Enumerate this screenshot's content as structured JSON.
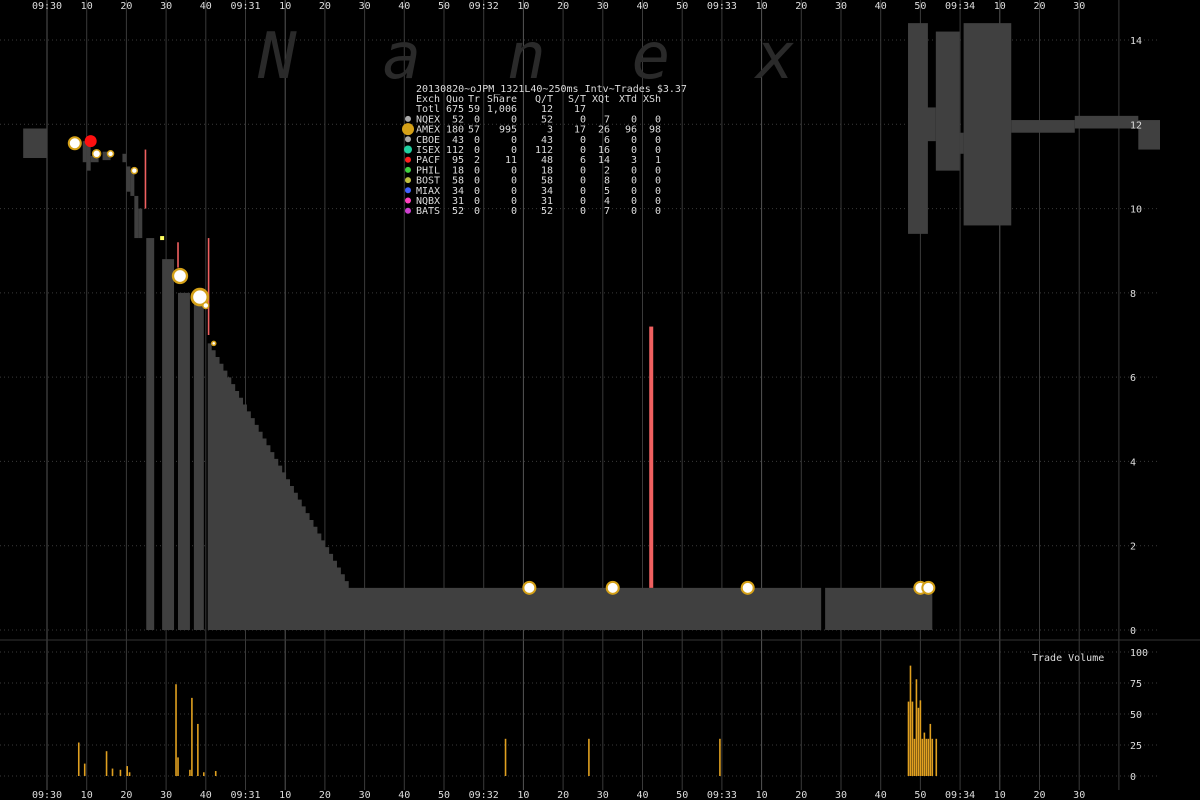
{
  "title": "20130820~oJPM_1321L40~250ms Intv~Trades $3.37",
  "watermark": "Nanex",
  "volume_label": "Trade Volume",
  "colors": {
    "background": "#000000",
    "grid": "#3a3a3a",
    "quote_band": "#404040",
    "text": "#dddddd",
    "pacf_spike": "#f06060",
    "volume_bar": "#e0a020",
    "amex_marker": "#d4a017"
  },
  "exchange_table": {
    "headers": [
      "Exch",
      "Quo",
      "Tr",
      "Share",
      "Q/T",
      "S/T",
      "XQt",
      "XTd",
      "XSh"
    ],
    "total": [
      "Totl",
      "675",
      "59",
      "1,006",
      "12",
      "17",
      "",
      "",
      ""
    ],
    "rows": [
      {
        "exch": "NQEX",
        "color": "#aaaaaa",
        "dot": 3,
        "cells": [
          "52",
          "0",
          "0",
          "52",
          "0",
          "7",
          "0",
          "0"
        ]
      },
      {
        "exch": "AMEX",
        "color": "#d4a017",
        "dot": 6,
        "cells": [
          "180",
          "57",
          "995",
          "3",
          "17",
          "26",
          "96",
          "98"
        ]
      },
      {
        "exch": "CBOE",
        "color": "#aaaaaa",
        "dot": 3,
        "cells": [
          "43",
          "0",
          "0",
          "43",
          "0",
          "6",
          "0",
          "0"
        ]
      },
      {
        "exch": "ISEX",
        "color": "#20d0a0",
        "dot": 4,
        "cells": [
          "112",
          "0",
          "0",
          "112",
          "0",
          "16",
          "0",
          "0"
        ]
      },
      {
        "exch": "PACF",
        "color": "#ff2020",
        "dot": 3,
        "cells": [
          "95",
          "2",
          "11",
          "48",
          "6",
          "14",
          "3",
          "1"
        ]
      },
      {
        "exch": "PHIL",
        "color": "#40d040",
        "dot": 3,
        "cells": [
          "18",
          "0",
          "0",
          "18",
          "0",
          "2",
          "0",
          "0"
        ]
      },
      {
        "exch": "BOST",
        "color": "#c0c040",
        "dot": 3,
        "cells": [
          "58",
          "0",
          "0",
          "58",
          "0",
          "8",
          "0",
          "0"
        ]
      },
      {
        "exch": "MIAX",
        "color": "#4060ff",
        "dot": 3,
        "cells": [
          "34",
          "0",
          "0",
          "34",
          "0",
          "5",
          "0",
          "0"
        ]
      },
      {
        "exch": "NQBX",
        "color": "#ff40c0",
        "dot": 3,
        "cells": [
          "31",
          "0",
          "0",
          "31",
          "0",
          "4",
          "0",
          "0"
        ]
      },
      {
        "exch": "BATS",
        "color": "#d040d0",
        "dot": 3,
        "cells": [
          "52",
          "0",
          "0",
          "52",
          "0",
          "7",
          "0",
          "0"
        ]
      }
    ]
  },
  "chart_data": [
    {
      "type": "area",
      "panel": "price",
      "x_unit": "seconds after 09:30:00",
      "xlim": [
        0,
        275
      ],
      "ylim": [
        0,
        14.6
      ],
      "y_ticks": [
        0,
        2,
        4,
        6,
        8,
        10,
        12,
        14
      ],
      "x_tick_labels": [
        "09:30",
        "10",
        "20",
        "30",
        "40",
        "09:31",
        "10",
        "20",
        "30",
        "40",
        "50",
        "09:32",
        "10",
        "20",
        "30",
        "40",
        "50",
        "09:33",
        "10",
        "20",
        "30",
        "40",
        "50",
        "09:34",
        "10",
        "20",
        "30"
      ],
      "x_major_ticks": [
        0,
        60,
        120,
        180,
        240
      ],
      "x_minor_step": 10,
      "grid": true,
      "quote_band": [
        {
          "x0": -6,
          "x1": 0,
          "lo": 11.2,
          "hi": 11.9
        },
        {
          "x0": 9,
          "x1": 10,
          "lo": 11.1,
          "hi": 11.6
        },
        {
          "x0": 10,
          "x1": 11,
          "lo": 10.9,
          "hi": 11.5
        },
        {
          "x0": 11,
          "x1": 13,
          "lo": 11.1,
          "hi": 11.25
        },
        {
          "x0": 14,
          "x1": 16,
          "lo": 11.15,
          "hi": 11.35
        },
        {
          "x0": 19,
          "x1": 20,
          "lo": 11.1,
          "hi": 11.3
        },
        {
          "x0": 20,
          "x1": 21,
          "lo": 10.4,
          "hi": 11.0
        },
        {
          "x0": 21,
          "x1": 22,
          "lo": 10.3,
          "hi": 10.9
        },
        {
          "x0": 22,
          "x1": 23,
          "lo": 9.3,
          "hi": 10.3
        },
        {
          "x0": 23,
          "x1": 24,
          "lo": 9.3,
          "hi": 10.0
        },
        {
          "x0": 25,
          "x1": 27,
          "lo": 0,
          "hi": 9.3
        },
        {
          "x0": 29,
          "x1": 32,
          "lo": 0,
          "hi": 8.8
        },
        {
          "x0": 33,
          "x1": 36,
          "lo": 0,
          "hi": 8.0
        },
        {
          "x0": 37,
          "x1": 39.5,
          "lo": 0,
          "hi": 7.8
        },
        {
          "x0": 40.5,
          "x1": 195,
          "lo": 0,
          "hi": 6.8,
          "descending_to": 1.0,
          "descend_end": 76
        },
        {
          "x0": 196,
          "x1": 223,
          "lo": 0,
          "hi": 1.0
        }
      ],
      "upper_band": [
        {
          "x0": 232,
          "x1": 237,
          "lo": 9.4,
          "hi": 14.4
        },
        {
          "x0": 232,
          "x1": 239,
          "lo": 11.6,
          "hi": 12.4
        },
        {
          "x0": 239,
          "x1": 245,
          "lo": 10.9,
          "hi": 14.2
        },
        {
          "x0": 245,
          "x1": 246,
          "lo": 11.3,
          "hi": 11.8
        },
        {
          "x0": 246,
          "x1": 258,
          "lo": 9.6,
          "hi": 14.4
        },
        {
          "x0": 258,
          "x1": 274,
          "lo": 11.8,
          "hi": 12.1
        },
        {
          "x0": 274,
          "x1": 290,
          "lo": 11.9,
          "hi": 12.2
        },
        {
          "x0": 290,
          "x1": 299,
          "lo": 11.4,
          "hi": 12.1
        }
      ],
      "pacf_spikes": [
        {
          "x": 24.8,
          "lo": 10.0,
          "hi": 11.4
        },
        {
          "x": 33.0,
          "lo": 8.6,
          "hi": 9.2
        },
        {
          "x": 40.7,
          "lo": 7.0,
          "hi": 9.3
        },
        {
          "x": 152.2,
          "lo": 1.0,
          "hi": 7.2
        }
      ],
      "series": [
        {
          "name": "AMEX",
          "marker": "white-ring",
          "points": [
            {
              "x": 7.0,
              "y": 11.55,
              "size": 6
            },
            {
              "x": 12.5,
              "y": 11.3,
              "size": 4
            },
            {
              "x": 16.0,
              "y": 11.3,
              "size": 3
            },
            {
              "x": 22.0,
              "y": 10.9,
              "size": 3
            },
            {
              "x": 33.5,
              "y": 8.4,
              "size": 7
            },
            {
              "x": 38.5,
              "y": 7.9,
              "size": 8
            },
            {
              "x": 40.0,
              "y": 7.7,
              "size": 3
            },
            {
              "x": 42.0,
              "y": 6.8,
              "size": 2
            },
            {
              "x": 121.5,
              "y": 1.0,
              "size": 6
            },
            {
              "x": 142.5,
              "y": 1.0,
              "size": 6
            },
            {
              "x": 176.5,
              "y": 1.0,
              "size": 6
            },
            {
              "x": 220.0,
              "y": 1.0,
              "size": 6
            },
            {
              "x": 222.0,
              "y": 1.0,
              "size": 6
            }
          ]
        },
        {
          "name": "PACF",
          "marker": "red-dot",
          "points": [
            {
              "x": 11.0,
              "y": 11.6,
              "size": 6
            }
          ]
        },
        {
          "name": "BOST",
          "marker": "yellow-square",
          "points": [
            {
              "x": 29.0,
              "y": 9.3,
              "size": 2
            }
          ]
        }
      ]
    },
    {
      "type": "bar",
      "panel": "volume",
      "title": "Trade Volume",
      "ylim": [
        0,
        100
      ],
      "y_ticks": [
        0,
        25,
        50,
        75,
        100
      ],
      "x": [
        8,
        9.5,
        15,
        16.5,
        18.5,
        20.2,
        20.8,
        32.5,
        33,
        36,
        36.5,
        38,
        39.5,
        42.5,
        115.5,
        136.5,
        169.5,
        217,
        217.5,
        218,
        218.5,
        219,
        219.5,
        220,
        220.5,
        221,
        221.5,
        222,
        222.5,
        223,
        224
      ],
      "values": [
        27,
        10,
        20,
        6,
        5,
        8,
        3,
        74,
        15,
        5,
        63,
        42,
        3,
        4,
        30,
        30,
        30,
        60,
        89,
        60,
        30,
        78,
        55,
        61,
        30,
        35,
        30,
        30,
        42,
        30,
        30
      ]
    }
  ]
}
